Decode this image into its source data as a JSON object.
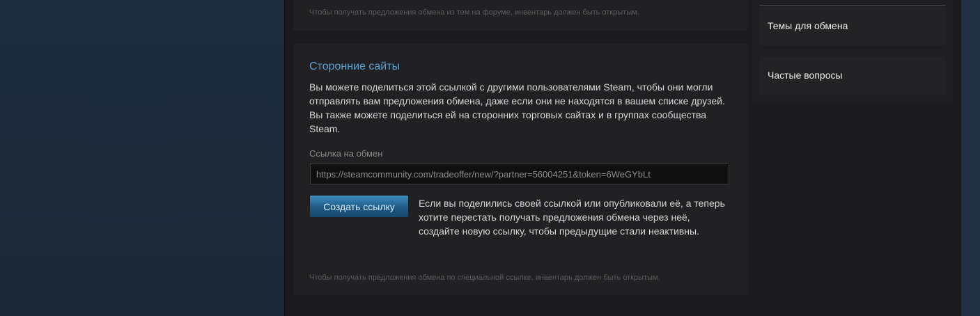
{
  "top_section": {
    "note": "Чтобы получать предложения обмена из тем на форуме, инвентарь должен быть открытым."
  },
  "third_party": {
    "title": "Сторонние сайты",
    "description": "Вы можете поделиться этой ссылкой с другими пользователями Steam, чтобы они могли отправлять вам предложения обмена, даже если они не находятся в вашем списке друзей. Вы также можете поделиться ей на сторонних торговых сайтах и в группах сообщества Steam.",
    "link_label": "Ссылка на обмен",
    "link_value": "https://steamcommunity.com/tradeoffer/new/?partner=56004251&token=6WeGYbLt",
    "create_button_label": "Создать ссылку",
    "create_note": "Если вы поделились своей ссылкой или опубликовали её, а теперь хотите перестать получать предложения обмена через неё, создайте новую ссылку, чтобы предыдущие стали неактивны.",
    "bottom_note": "Чтобы получать предложения обмена по специальной ссылке, инвентарь должен быть открытым."
  },
  "sidebar": {
    "items": [
      {
        "label": "Темы для обмена"
      },
      {
        "label": "Частые вопросы"
      }
    ]
  },
  "colors": {
    "page_background": "#1b2838",
    "panel_background": "#212123",
    "accent": "#5ba4d6",
    "button": "#1e5a85"
  }
}
